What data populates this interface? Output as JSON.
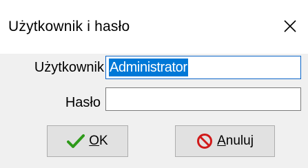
{
  "dialog": {
    "title": "Użytkownik i hasło",
    "close_glyph": "✕"
  },
  "form": {
    "username_label": "Użytkownik",
    "username_value": "Administrator",
    "password_label": "Hasło",
    "password_value": ""
  },
  "buttons": {
    "ok": {
      "mnemonic": "O",
      "rest": "K",
      "icon": "checkmark-icon",
      "icon_color": "#2e9a1a"
    },
    "cancel": {
      "mnemonic": "A",
      "rest": "nuluj",
      "icon": "no-entry-icon",
      "icon_color": "#d11a1a"
    }
  },
  "colors": {
    "selection": "#0078d7",
    "focus_border": "#0a64c8"
  }
}
